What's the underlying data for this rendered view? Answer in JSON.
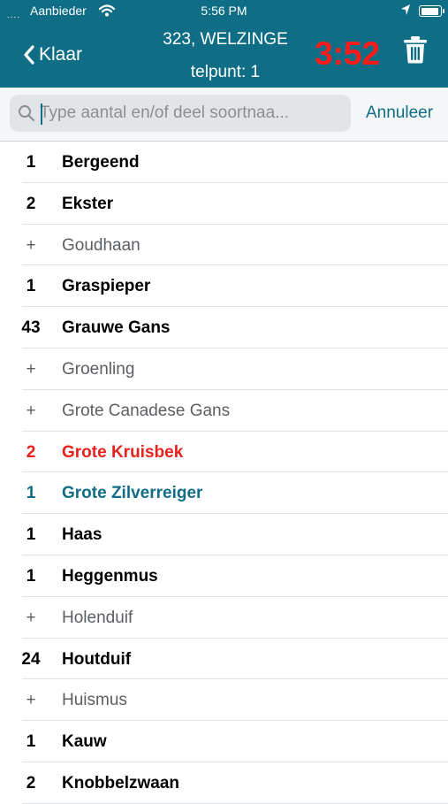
{
  "status_bar": {
    "dots": "....",
    "carrier": "Aanbieder",
    "time": "5:56 PM",
    "icons": [
      "wifi-icon",
      "location-arrow-icon",
      "battery-icon"
    ]
  },
  "nav": {
    "back_label": "Klaar",
    "title": "323, WELZINGE",
    "subtitle": "telpunt: 1",
    "timer": "3:52",
    "trash_icon": "trash-icon",
    "header_color": "#0f6e86",
    "timer_color": "#ff1a1a"
  },
  "search": {
    "placeholder": "Type aantal en/of deel soortnaa...",
    "value": "",
    "cancel_label": "Annuleer"
  },
  "colors": {
    "accent": "#0f6e86",
    "highlight_red": "#e8211d",
    "muted_gray": "#5b5e62"
  },
  "species": [
    {
      "count": "1",
      "name": "Bergeend",
      "style": "bold"
    },
    {
      "count": "2",
      "name": "Ekster",
      "style": "bold"
    },
    {
      "count": "+",
      "name": "Goudhaan",
      "style": "plus"
    },
    {
      "count": "1",
      "name": "Graspieper",
      "style": "bold"
    },
    {
      "count": "43",
      "name": "Grauwe Gans",
      "style": "bold"
    },
    {
      "count": "+",
      "name": "Groenling",
      "style": "plus"
    },
    {
      "count": "+",
      "name": "Grote Canadese Gans",
      "style": "plus"
    },
    {
      "count": "2",
      "name": "Grote Kruisbek",
      "style": "red"
    },
    {
      "count": "1",
      "name": "Grote Zilverreiger",
      "style": "blue"
    },
    {
      "count": "1",
      "name": "Haas",
      "style": "bold"
    },
    {
      "count": "1",
      "name": "Heggenmus",
      "style": "bold"
    },
    {
      "count": "+",
      "name": "Holenduif",
      "style": "plus"
    },
    {
      "count": "24",
      "name": "Houtduif",
      "style": "bold"
    },
    {
      "count": "+",
      "name": "Huismus",
      "style": "plus"
    },
    {
      "count": "1",
      "name": "Kauw",
      "style": "bold"
    },
    {
      "count": "2",
      "name": "Knobbelzwaan",
      "style": "bold"
    }
  ]
}
